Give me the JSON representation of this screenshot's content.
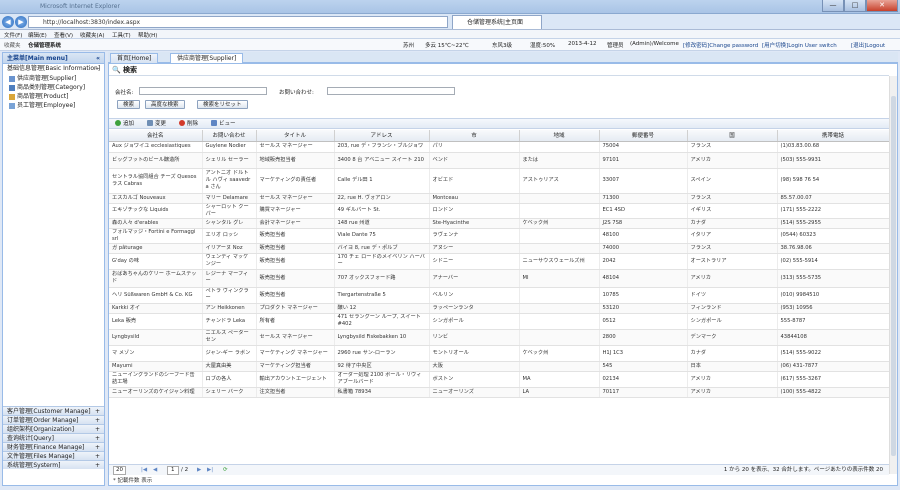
{
  "browser": {
    "title": "Microsoft Internet Explorer",
    "url": "http://localhost:3830/index.aspx",
    "tab": "仓储管理系统|主页面",
    "back": "◀",
    "forward": "▶",
    "minimize": "—",
    "maximize": "□",
    "close": "✕"
  },
  "menubar": [
    "文件(F)",
    "编辑(E)",
    "查看(V)",
    "收藏夹(A)",
    "工具(T)",
    "帮助(H)"
  ],
  "favbar": {
    "item": "收藏夹",
    "sysname": "仓储管理系统"
  },
  "sysbar": {
    "location": "苏州",
    "weather": "多云 15℃~22℃",
    "wind": "东风3级",
    "humidity": "湿度:50%",
    "date": "2013-4-12",
    "user": "管理员",
    "welcome": "(Admin)/Welcome",
    "change_password": "[修改密码]Change password",
    "login_user_switch": "[用户切换]Login User switch",
    "logout": "[退出]Logout"
  },
  "leftpanel": {
    "title": "主菜单[Main menu]",
    "collapse": "«",
    "group_basic": "基础信息管理[Basic Information]",
    "group_basic_mark": "−",
    "items": [
      "供应商管理[Supplier]",
      "商品类别管理[Category]",
      "商品管理[Product]",
      "员工管理[Employee]"
    ],
    "groups": [
      {
        "label": "客户管理[Customer Manage]",
        "mark": "+"
      },
      {
        "label": "订单管理[Order Manage]",
        "mark": "+"
      },
      {
        "label": "组织架构[Organization]",
        "mark": "+"
      },
      {
        "label": "查询统计[Query]",
        "mark": "+"
      },
      {
        "label": "财务管理[Finance Manage]",
        "mark": "+"
      },
      {
        "label": "文件管理[Files Manage]",
        "mark": "+"
      },
      {
        "label": "系统管理[Systerm]",
        "mark": "+"
      }
    ]
  },
  "tabs": [
    {
      "label": "首页[Home]",
      "active": false
    },
    {
      "label": "供应商管理[Supplier]",
      "active": true
    }
  ],
  "search": {
    "title": "検索",
    "company_label": "会社名:",
    "contact_label": "お問い合わせ:",
    "btn_search": "検索",
    "btn_advanced": "高度な検索",
    "btn_reset": "検索をリセット"
  },
  "toolbar": {
    "add": "追加",
    "edit": "変更",
    "delete": "削除",
    "view": "ビュー"
  },
  "grid": {
    "columns": [
      "会社名",
      "お問い合わせ",
      "タイトル",
      "アドレス",
      "市",
      "地域",
      "郵便番号",
      "国",
      "携帯電話"
    ],
    "rows": [
      [
        "Aux ジョワイユ ecclesiastiques",
        "Guylene Nodier",
        "セールス マネージャー",
        "203, rue デ・フランシ・ブルジョワ",
        "パリ",
        "",
        "75004",
        "フランス",
        "(1)03.83.00.68"
      ],
      [
        "ビッグフットのビール醸造所",
        "シェリル セーラー",
        "地域販売担当者",
        "3400 8 台 アベニュー スイート 210",
        "ベンド",
        "または",
        "97101",
        "アメリカ",
        "(503) 555-9931"
      ],
      [
        "セントラル協同組合 チーズ Quesos ラス Cabras",
        "アントニオ ドルトル ハヴィ saavedra さん",
        "マーケティングの責任者",
        "Calle デル田 1",
        "オビエド",
        "アストゥリアス",
        "33007",
        "スペイン",
        "(98) 598 76 54"
      ],
      [
        "エスカルゴ Nouveaux",
        "マリー Delamare",
        "セールス マネージャー",
        "22, rue H. ヴォアロン",
        "Montceau",
        "",
        "71300",
        "フランス",
        "85.57.00.07"
      ],
      [
        "エキゾチックな Liquids",
        "シャーロット クーパー",
        "購買マネージャー",
        "49 ギルバート St.",
        "ロンドン",
        "",
        "EC1 4SD",
        "イギリス",
        "(171) 555-2222"
      ],
      [
        "森の人々 d'erables",
        "シャンタル グレ",
        "会計マネージャー",
        "148 rue 州道",
        "Ste-Hyacinthe",
        "ケベック州",
        "J2S 7S8",
        "カナダ",
        "(514) 555-2955"
      ],
      [
        "フォルマッジ・Fortini e Formaggi srl",
        "エリオ ロッシ",
        "販売担当者",
        "Viale Dante 75",
        "ラヴェンナ",
        "",
        "48100",
        "イタリア",
        "(0544) 60323"
      ],
      [
        "ガ pâturage",
        "イリアーヌ Noz",
        "販売担当者",
        "バイヨ 8, rue デ・ポルブ",
        "アヌシー",
        "",
        "74000",
        "フランス",
        "38.76.98.06"
      ],
      [
        "G'day の味",
        "ウェンディ マッケンジー",
        "販売担当者",
        "170 チェ ロードのメイベリン ハーバー",
        "シドニー",
        "ニューサウスウェールズ州",
        "2042",
        "オーストラリア",
        "(02) 555-5914"
      ],
      [
        "おばあちゃんのケリー ホームステッド",
        "レジーナ マーフィー",
        "販売担当者",
        "707 オックスフォード路",
        "アナーバー",
        "MI",
        "48104",
        "アメリカ",
        "(313) 555-5735"
      ],
      [
        "ヘリ Süßwaren GmbH & Co. KG",
        "ペトラ ヴィンクラー",
        "販売担当者",
        "Tiergartenstraße 5",
        "ベルリン",
        "",
        "10785",
        "ドイツ",
        "(010) 9984510"
      ],
      [
        "Karkki オイ",
        "アン Heikkonen",
        "プロダクト マネージャー",
        "醸い 12",
        "ラッペーンランタ",
        "",
        "53120",
        "フィンランド",
        "(953) 10956"
      ],
      [
        "Leka 販売",
        "チャンドラ Leka",
        "所有者",
        "471 セラングーン ループ, スイート #402",
        "シンガポール",
        "",
        "0512",
        "シンガポール",
        "555-8787"
      ],
      [
        "Lyngbysild",
        "ニエルス ペーターセン",
        "セールス マネージャー",
        "Lyngbysild Fiskebakken 10",
        "リンビ",
        "",
        "2800",
        "デンマーク",
        "43844108"
      ],
      [
        "マ メゾン",
        "ジャン-ギー ラボン",
        "マーケティング マネージャー",
        "2960 rue サン-ローラン",
        "モントリオール",
        "ケベック州",
        "H1J 1C3",
        "カナダ",
        "(514) 555-9022"
      ],
      [
        "Mayumi",
        "大屋真由美",
        "マーケティング担当者",
        "92 待了中央区",
        "大阪",
        "",
        "545",
        "日本",
        "(06) 431-7877"
      ],
      [
        "ニューイングランドのシーフード缶詰工場",
        "ロブの各人",
        "輸出アカウントエージェント",
        "オーダー処理 2100 ポール・リヴィアブールバード",
        "ボストン",
        "MA",
        "02134",
        "アメリカ",
        "(617) 555-3267"
      ],
      [
        "ニューオーリンズのケイジャン料理",
        "シェリー バーク",
        "注文担当者",
        "私書箱 78934",
        "ニューオーリンズ",
        "LA",
        "70117",
        "アメリカ",
        "(100) 555-4822"
      ]
    ]
  },
  "pager": {
    "page_size": "20",
    "page": "1",
    "total_pages": "/ 2",
    "info": "1 から 20 を表示、32 合計します。ページあたりの表示件数 20"
  },
  "footnote": "* 記載件数 表示"
}
